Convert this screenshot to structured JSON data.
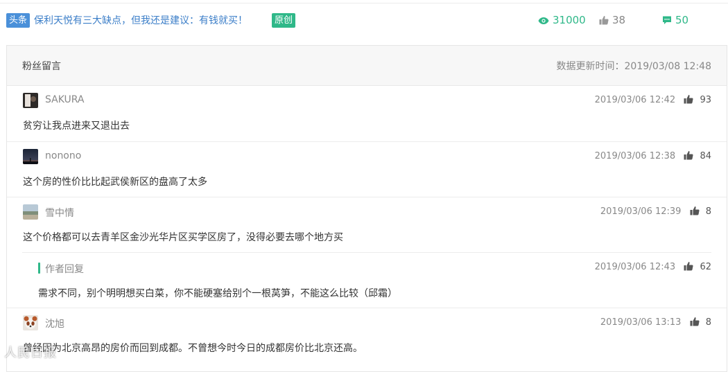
{
  "header": {
    "tag_toutiao": "头条",
    "article_title": "保利天悦有三大缺点，但我还是建议：有钱就买！",
    "tag_original": "原创",
    "views": "31000",
    "likes": "38",
    "comments": "50",
    "colors": {
      "accent_green": "#2fb889",
      "accent_blue": "#4a90d9"
    }
  },
  "panel": {
    "title": "粉丝留言",
    "update_time": "数据更新时间：2019/03/08 12:48"
  },
  "comments": [
    {
      "user": "SAKURA",
      "time": "2019/03/06 12:42",
      "likes": "93",
      "text": "贫穷让我点进来又退出去",
      "avatar": "avatar-photo-dark"
    },
    {
      "user": "nonono",
      "time": "2019/03/06 12:38",
      "likes": "84",
      "text": "这个房的性价比比起武侯新区的盘高了太多",
      "avatar": "avatar-sunset"
    },
    {
      "user": "雪中情",
      "time": "2019/03/06 12:39",
      "likes": "8",
      "text": "这个价格都可以去青羊区金沙光华片区买学区房了，没得必要去哪个地方买",
      "avatar": "avatar-landscape",
      "reply": {
        "label": "作者回复",
        "time": "2019/03/06 12:43",
        "likes": "62",
        "text": "需求不同，别个明明想买白菜，你不能硬塞给别个一根莴笋，不能这么比较（邱霜）"
      }
    },
    {
      "user": "沈旭",
      "time": "2019/03/06 13:13",
      "likes": "8",
      "text": "曾经因为北京高昂的房价而回到成都。不曾想今时今日的成都房价比北京还高。",
      "avatar": "avatar-panda"
    }
  ],
  "watermark": "人民日报"
}
